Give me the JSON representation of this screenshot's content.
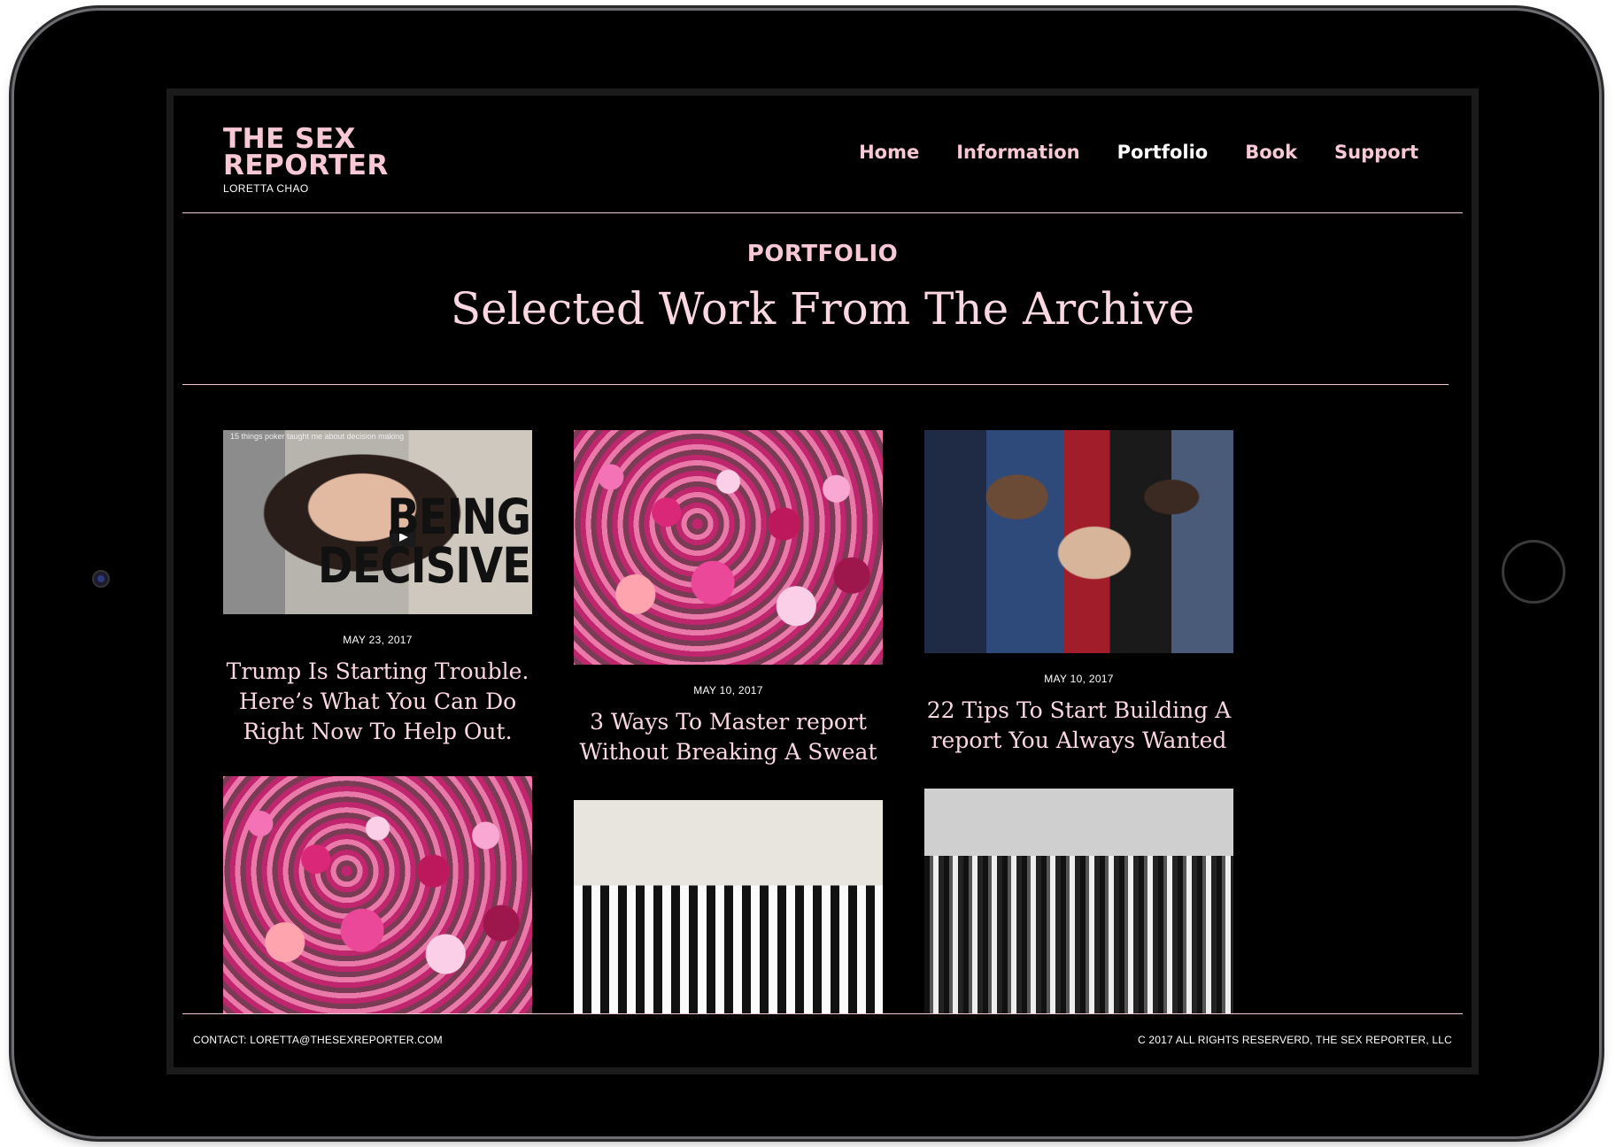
{
  "header": {
    "logo_title": "THE SEX REPORTER",
    "logo_subtitle": "LORETTA CHAO",
    "nav": [
      {
        "label": "Home"
      },
      {
        "label": "Information"
      },
      {
        "label": "Portfolio"
      },
      {
        "label": "Book"
      },
      {
        "label": "Support"
      }
    ]
  },
  "hero": {
    "eyebrow": "PORTFOLIO",
    "headline": "Selected Work From The Archive"
  },
  "posts": [
    {
      "date": "MAY 23, 2017",
      "title": "Trump Is Starting Trouble. Here’s What You Can Do Right Now To Help Out.",
      "video_caption": "15 things poker taught me about decision making",
      "overlay_text": "BEING DECISIVE",
      "icon": "play-icon"
    },
    {
      "date": "MAY 10, 2017",
      "title": "3 Ways To Master report Without Breaking A Sweat"
    },
    {
      "date": "MAY 10, 2017",
      "title": "22 Tips To Start Building A report You Always Wanted"
    }
  ],
  "footer": {
    "contact": "CONTACT: LORETTA@THESEXREPORTER.COM",
    "copyright": "C 2017 ALL RIGHTS RESERVERD, THE SEX REPORTER, LLC"
  },
  "colors": {
    "background": "#000000",
    "accent_pink": "#f9c8d6",
    "text_white": "#ffffff"
  }
}
